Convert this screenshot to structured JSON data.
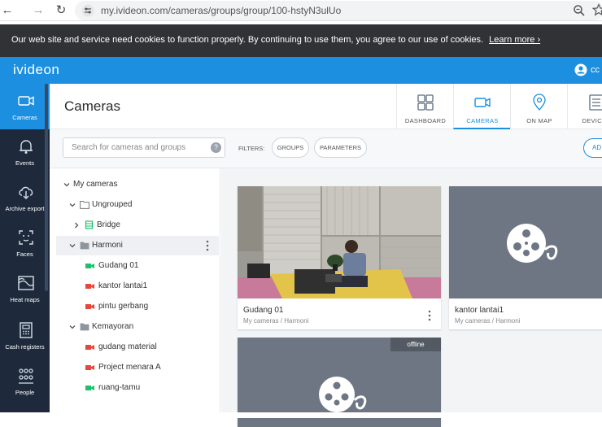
{
  "browser": {
    "url": "my.ivideon.com/cameras/groups/group/100-hstyN3ulUo"
  },
  "cookie": {
    "text": "Our web site and service need cookies to function properly. By continuing to use them, you agree to our use of cookies.",
    "link": "Learn more ›"
  },
  "header": {
    "logo": "ivideon",
    "user": "cc"
  },
  "leftnav": {
    "items": [
      {
        "label": "Cameras",
        "icon": "camera-icon"
      },
      {
        "label": "Events",
        "icon": "bell-icon"
      },
      {
        "label": "Archive export",
        "icon": "cloud-download-icon"
      },
      {
        "label": "Faces",
        "icon": "face-icon"
      },
      {
        "label": "Heat maps",
        "icon": "heatmap-icon"
      },
      {
        "label": "Cash registers",
        "icon": "cash-register-icon"
      },
      {
        "label": "People",
        "icon": "people-icon"
      }
    ]
  },
  "page": {
    "title": "Cameras",
    "tabs": [
      {
        "label": "DASHBOARD",
        "icon": "dashboard-icon"
      },
      {
        "label": "CAMERAS",
        "icon": "camera-icon"
      },
      {
        "label": "ON MAP",
        "icon": "map-pin-icon"
      },
      {
        "label": "DEVICES",
        "icon": "device-icon"
      }
    ]
  },
  "filters": {
    "search_placeholder": "Search for cameras and groups",
    "label": "FILTERS:",
    "groups": "GROUPS",
    "parameters": "PARAMETERS",
    "add": "AD"
  },
  "tree": {
    "rows": [
      {
        "label": "My cameras"
      },
      {
        "label": "Ungrouped"
      },
      {
        "label": "Bridge"
      },
      {
        "label": "Harmoni"
      },
      {
        "label": "Gudang 01",
        "status": "online"
      },
      {
        "label": "kantor lantai1",
        "status": "offline"
      },
      {
        "label": "pintu gerbang",
        "status": "offline"
      },
      {
        "label": "Kemayoran"
      },
      {
        "label": "gudang material",
        "status": "offline"
      },
      {
        "label": "Project menara A",
        "status": "offline"
      },
      {
        "label": "ruang-tamu",
        "status": "online"
      }
    ]
  },
  "cards": [
    {
      "name": "Gudang 01",
      "path": "My cameras / Harmoni"
    },
    {
      "name": "kantor lantai1",
      "path": "My cameras / Harmoni"
    },
    {
      "badge": "offline"
    }
  ],
  "colors": {
    "brand": "#1c8fe0",
    "nav_bg": "#1e2a3c",
    "online": "#1bc26b",
    "offline": "#e8453c"
  }
}
